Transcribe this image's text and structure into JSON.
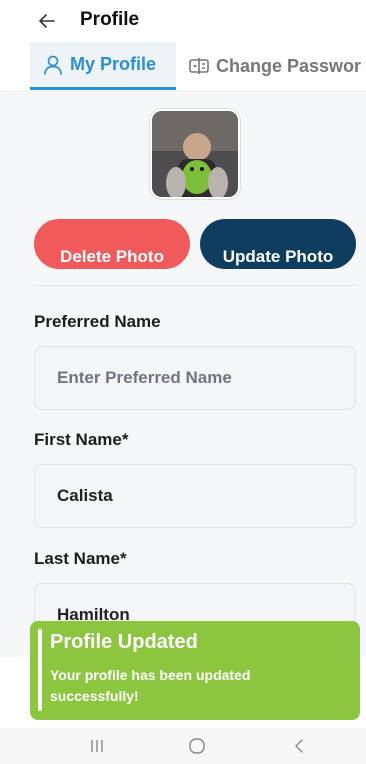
{
  "header": {
    "title": "Profile",
    "back_icon": "arrow-left-icon"
  },
  "tabs": [
    {
      "label": "My Profile",
      "icon": "user-icon",
      "active": true
    },
    {
      "label": "Change Passwor",
      "icon": "password-icon",
      "active": false
    }
  ],
  "photo": {
    "delete_label": "Delete Photo",
    "update_label": "Update Photo"
  },
  "form": {
    "preferred_name": {
      "label": "Preferred Name",
      "placeholder": "Enter Preferred Name",
      "value": ""
    },
    "first_name": {
      "label": "First Name*",
      "value": "Calista"
    },
    "last_name": {
      "label": "Last Name*",
      "value": "Hamilton"
    }
  },
  "toast": {
    "title": "Profile Updated",
    "message": "Your profile has been updated successfully!"
  },
  "colors": {
    "accent": "#2a8fd8",
    "delete": "#f05a5a",
    "update": "#0f3d5f",
    "toast": "#8cc63f"
  },
  "system_nav": [
    "recents-icon",
    "home-icon",
    "back-icon"
  ]
}
